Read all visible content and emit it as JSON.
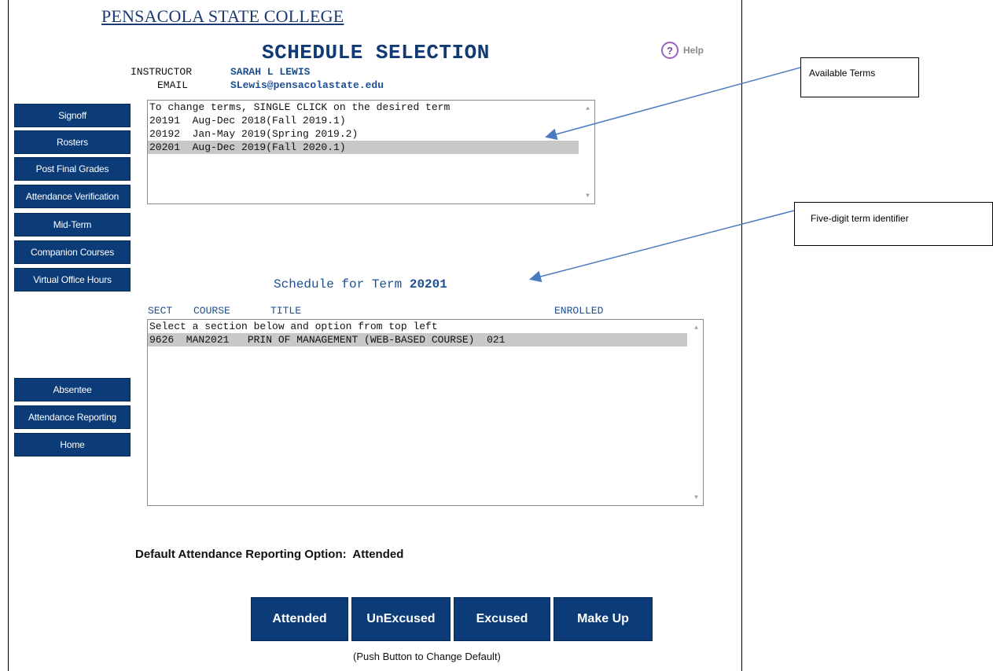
{
  "header": {
    "college": "PENSACOLA STATE COLLEGE",
    "title": "SCHEDULE SELECTION",
    "help_label": "Help",
    "help_glyph": "?"
  },
  "instructor": {
    "label": "INSTRUCTOR",
    "name": "SARAH L LEWIS",
    "email_label": "EMAIL",
    "email": "SLewis@pensacolastate.edu"
  },
  "sidebar_top": [
    {
      "label": "Signoff"
    },
    {
      "label": "Rosters"
    },
    {
      "label": "Post Final Grades"
    },
    {
      "label": "Attendance Verification"
    },
    {
      "label": "Mid-Term"
    },
    {
      "label": "Companion Courses"
    },
    {
      "label": "Virtual Office Hours"
    }
  ],
  "sidebar_bottom": [
    {
      "label": "Absentee"
    },
    {
      "label": "Attendance Reporting"
    },
    {
      "label": "Home"
    }
  ],
  "terms_list": {
    "instruction": "To change terms, SINGLE CLICK on the desired term",
    "items": [
      {
        "text": "20191  Aug-Dec 2018(Fall 2019.1)",
        "selected": false
      },
      {
        "text": "20192  Jan-May 2019(Spring 2019.2)",
        "selected": false
      },
      {
        "text": "20201  Aug-Dec 2019(Fall 2020.1)",
        "selected": true
      }
    ]
  },
  "schedule": {
    "label": "Schedule for Term",
    "term": "20201",
    "columns": {
      "sect": "SECT",
      "course": "COURSE",
      "title": "TITLE",
      "enrolled": "ENROLLED"
    },
    "instruction": "Select a section below and option from top left",
    "rows": [
      {
        "text": "9626  MAN2021   PRIN OF MANAGEMENT (WEB-BASED COURSE)  021",
        "selected": true
      }
    ]
  },
  "attendance": {
    "default_label": "Default Attendance Reporting Option:",
    "default_value": "Attended",
    "buttons": [
      "Attended",
      "UnExcused",
      "Excused",
      "Make Up"
    ],
    "note": "(Push Button to Change Default)"
  },
  "callouts": {
    "available_terms": "Available Terms",
    "term_identifier": "Five-digit term identifier"
  },
  "colors": {
    "nav_button": "#0c3c78",
    "heading_blue": "#1d4f91",
    "selected_row": "#c8c8c8",
    "help_purple": "#9b5fc0",
    "arrow": "#4a7abf"
  },
  "icons": {
    "help": "help-circle-icon",
    "scroll_up": "scroll-up-arrow-icon",
    "scroll_down": "scroll-down-arrow-icon"
  }
}
